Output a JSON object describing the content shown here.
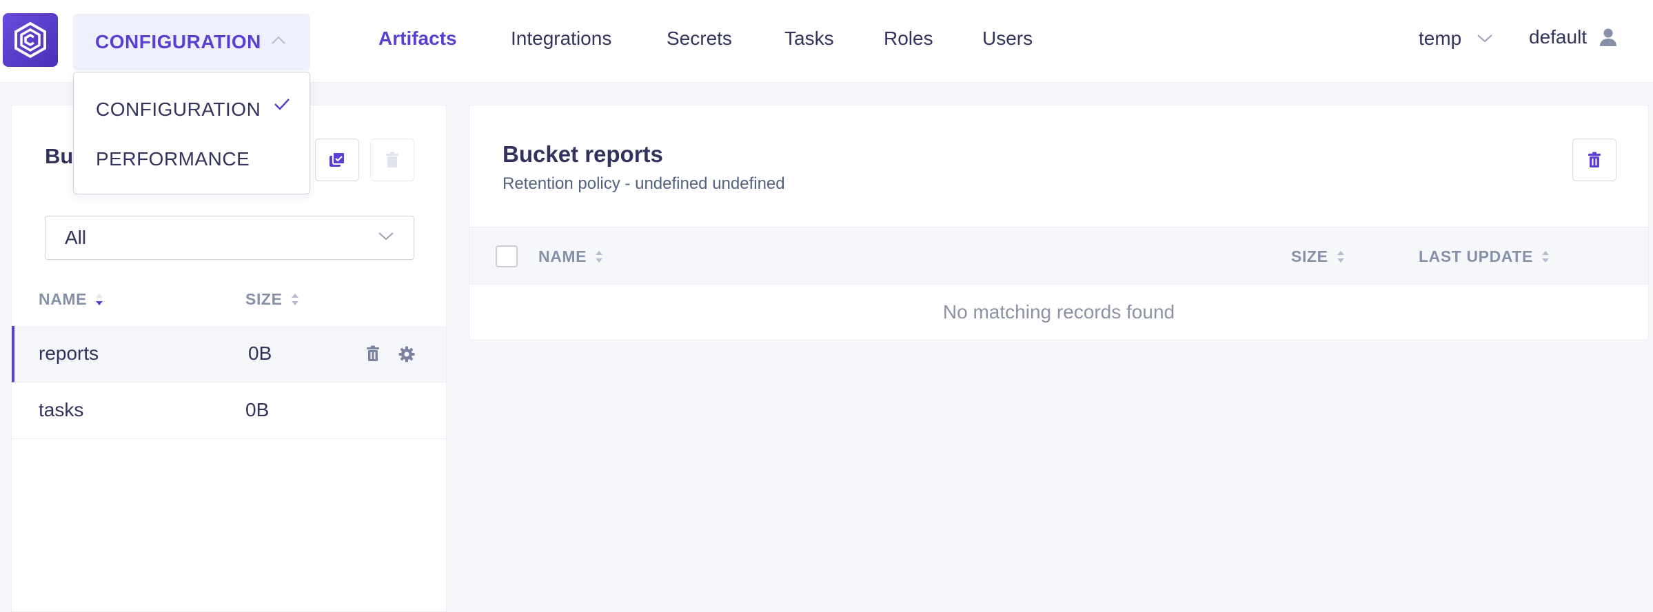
{
  "app": {
    "mode": "CONFIGURATION",
    "accent": "#5b3fd3"
  },
  "nav": {
    "items": [
      "Artifacts",
      "Integrations",
      "Secrets",
      "Tasks",
      "Roles",
      "Users"
    ],
    "active": "Artifacts"
  },
  "header": {
    "project": "temp",
    "user": "default"
  },
  "mode_menu": {
    "options": [
      "CONFIGURATION",
      "PERFORMANCE"
    ],
    "selected": "CONFIGURATION"
  },
  "buckets": {
    "title_visible": "Bu",
    "filter": "All",
    "columns": [
      "NAME",
      "SIZE"
    ],
    "rows": [
      {
        "name": "reports",
        "size": "0B"
      },
      {
        "name": "tasks",
        "size": "0B"
      }
    ]
  },
  "details": {
    "title": "Bucket reports",
    "subtitle": "Retention policy - undefined undefined",
    "columns": [
      "NAME",
      "SIZE",
      "LAST UPDATE"
    ],
    "empty_text": "No matching records found"
  },
  "icons": {
    "logo": "app-logo-icon",
    "chevron": "chevron-down-icon",
    "user": "user-icon",
    "trash": "trash-icon",
    "settings": "gear-icon",
    "copy_check": "copy-check-icon"
  }
}
